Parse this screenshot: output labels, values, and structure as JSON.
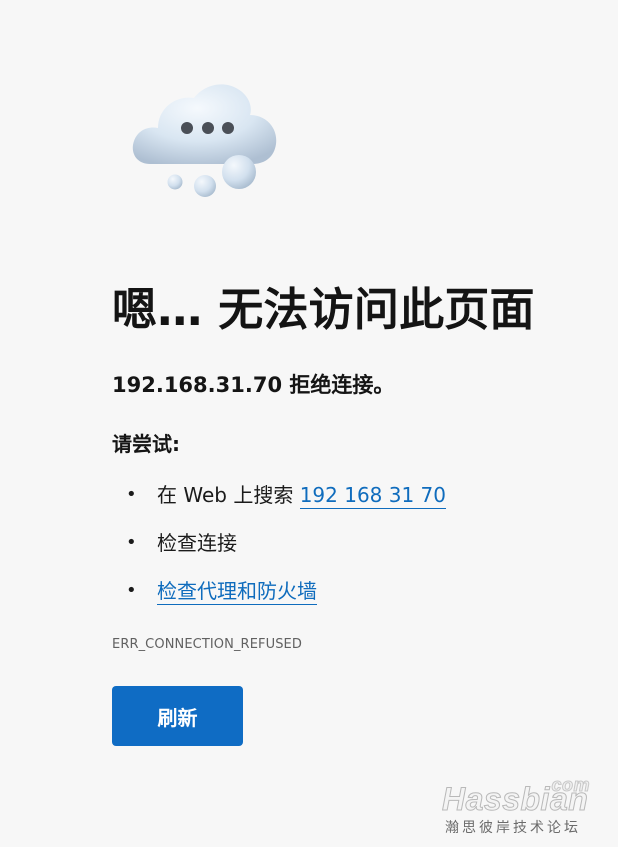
{
  "error_page": {
    "headline": "嗯… 无法访问此页面",
    "subhead": "192.168.31.70 拒绝连接。",
    "try_label": "请尝试:",
    "suggestions": {
      "search_prefix": "在 Web 上搜索 ",
      "search_link": "192 168 31 70",
      "check_connection": "检查连接",
      "check_proxy": "检查代理和防火墙"
    },
    "error_code": "ERR_CONNECTION_REFUSED",
    "refresh_label": "刷新"
  },
  "illustration": {
    "icon": "cloud-icon"
  },
  "watermark": {
    "suffix": "com",
    "brand": "Hassbian",
    "subtitle": "瀚思彼岸技术论坛"
  },
  "colors": {
    "background": "#f7f7f7",
    "link": "#0f6cbd",
    "button": "#0f6cc4",
    "error_code": "#616161"
  }
}
